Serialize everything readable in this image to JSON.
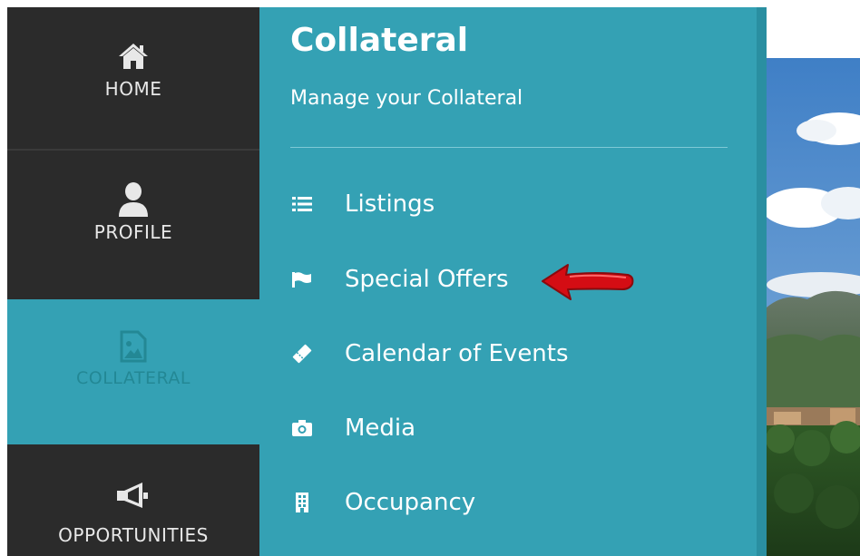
{
  "nav": {
    "items": [
      {
        "label": "HOME",
        "icon": "home-icon"
      },
      {
        "label": "PROFILE",
        "icon": "user-icon"
      },
      {
        "label": "COLLATERAL",
        "icon": "image-icon",
        "active": true
      },
      {
        "label": "OPPORTUNITIES",
        "icon": "megaphone-icon"
      }
    ]
  },
  "panel": {
    "title": "Collateral",
    "subtitle": "Manage your Collateral",
    "items": [
      {
        "label": "Listings",
        "icon": "list-icon"
      },
      {
        "label": "Special Offers",
        "icon": "flag-icon"
      },
      {
        "label": "Calendar of Events",
        "icon": "ticket-icon"
      },
      {
        "label": "Media",
        "icon": "camera-icon"
      },
      {
        "label": "Occupancy",
        "icon": "building-icon"
      }
    ]
  },
  "colors": {
    "nav_bg": "#2b2b2b",
    "accent": "#34a1b4",
    "callout": "#e0141c"
  }
}
